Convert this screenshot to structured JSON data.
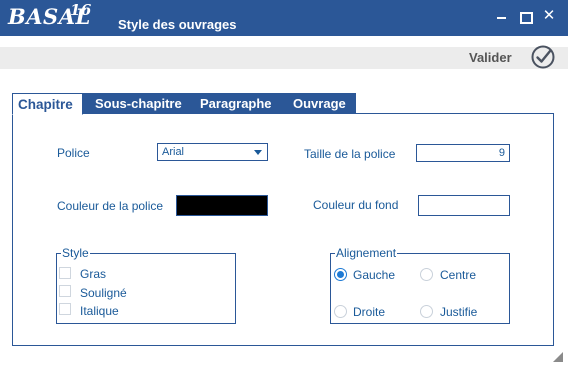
{
  "window": {
    "logo_text": "BASAL",
    "logo_version": "16",
    "title": "Style des ouvrages",
    "controls": [
      "minimize-icon",
      "maximize-icon",
      "close-icon"
    ],
    "close_glyph": "✕"
  },
  "toolbar": {
    "validate_label": "Valider",
    "validate_icon": "check-circle-icon"
  },
  "tabs": [
    {
      "label": "Chapitre",
      "active": true
    },
    {
      "label": "Sous-chapitre",
      "active": false
    },
    {
      "label": "Paragraphe",
      "active": false
    },
    {
      "label": "Ouvrage",
      "active": false
    }
  ],
  "form": {
    "font_label": "Police",
    "font_value": "Arial",
    "font_size_label": "Taille de la police",
    "font_size_value": "9",
    "font_color_label": "Couleur de la police",
    "font_color": "#000000",
    "bg_color_label": "Couleur du fond",
    "bg_color": "#ffffff"
  },
  "style_group": {
    "legend": "Style",
    "options": [
      {
        "label": "Gras",
        "checked": false
      },
      {
        "label": "Souligné",
        "checked": false
      },
      {
        "label": "Italique",
        "checked": false
      }
    ]
  },
  "align_group": {
    "legend": "Alignement",
    "options": [
      {
        "label": "Gauche",
        "checked": true
      },
      {
        "label": "Centre",
        "checked": false
      },
      {
        "label": "Droite",
        "checked": false
      },
      {
        "label": "Justifie",
        "checked": false
      }
    ]
  },
  "colors": {
    "titlebar": "#2b5797",
    "accent": "#2b5797",
    "label_text": "#1a5a99",
    "radio_selected": "#1e7ad4"
  }
}
